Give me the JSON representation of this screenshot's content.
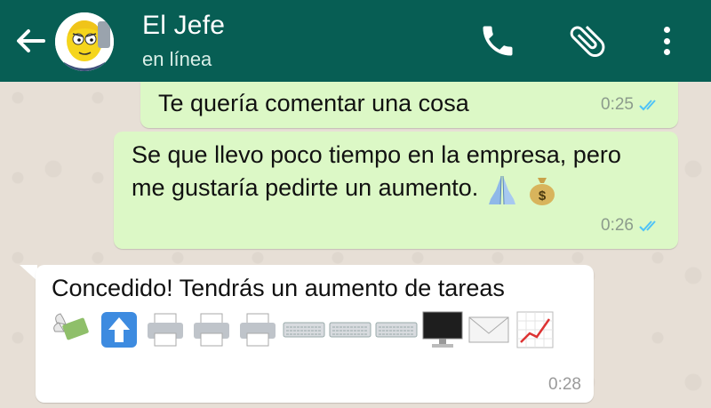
{
  "header": {
    "contact_name": "El Jefe",
    "status": "en línea",
    "icons": [
      "back-arrow-icon",
      "avatar",
      "phone-icon",
      "paperclip-icon",
      "more-vert-icon"
    ]
  },
  "messages": [
    {
      "direction": "out",
      "text": "Te quería comentar una cosa",
      "time": "0:25",
      "status": "read"
    },
    {
      "direction": "out",
      "text": "Se que llevo poco tiempo en la empresa, pero me gustaría pedirte un aumento.",
      "time": "0:26",
      "status": "read",
      "emojis": [
        "folded-hands",
        "money-bag"
      ]
    },
    {
      "direction": "in",
      "text": "Concedido! Tendrás un aumento de tareas",
      "time": "0:28",
      "emojis": [
        "money-with-wings",
        "up-arrow-button",
        "printer",
        "printer",
        "printer",
        "keyboard",
        "keyboard",
        "keyboard",
        "desktop-computer",
        "envelope",
        "chart-increasing"
      ]
    }
  ],
  "colors": {
    "header": "#075e54",
    "outgoing_bubble": "#dcf8c6",
    "incoming_bubble": "#ffffff",
    "read_ticks": "#4fc3f7",
    "background": "#e7dfd6"
  }
}
